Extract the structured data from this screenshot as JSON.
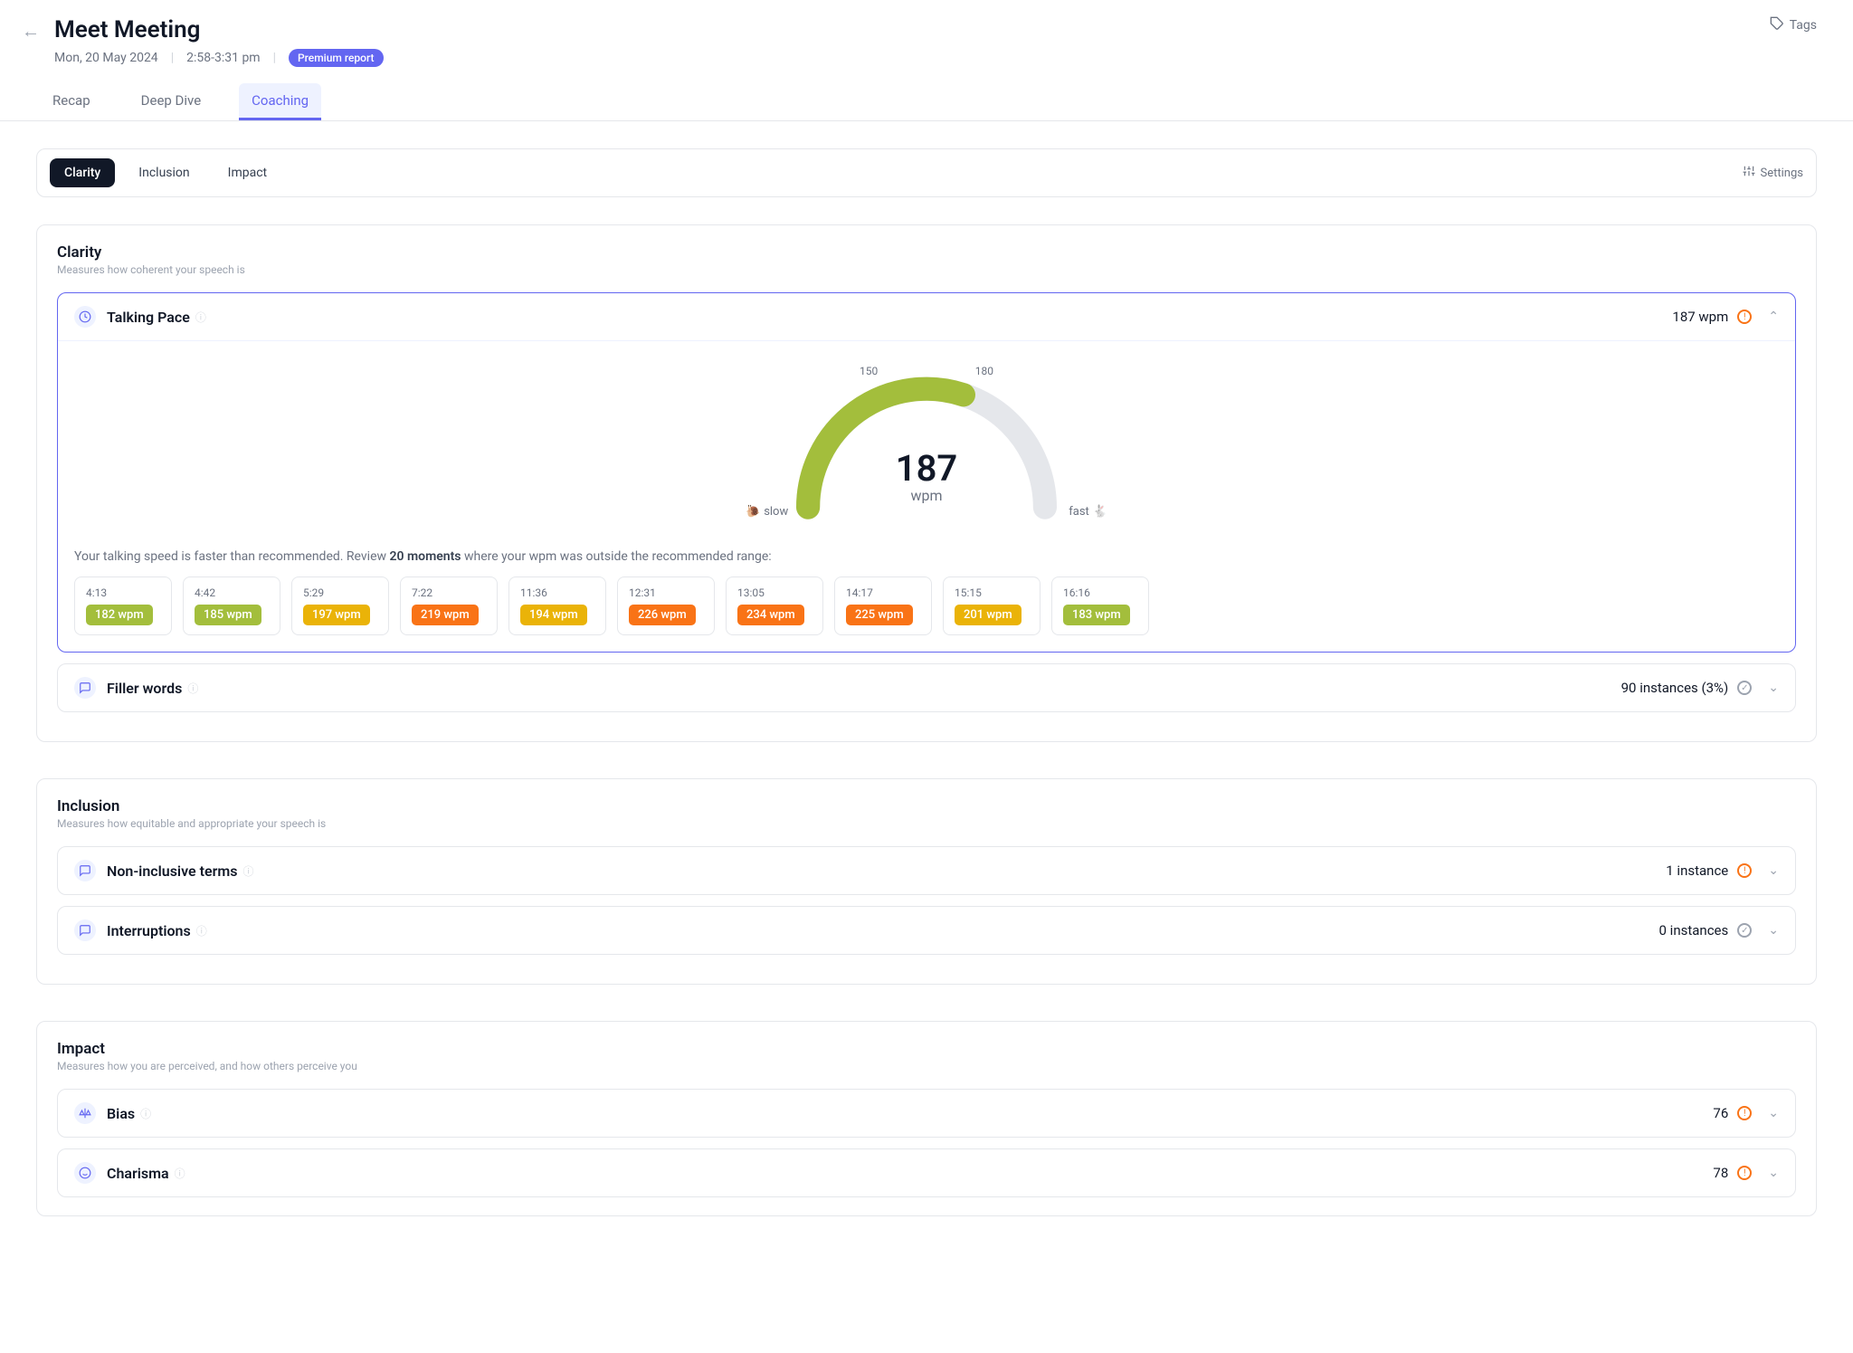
{
  "header": {
    "title": "Meet Meeting",
    "date": "Mon, 20 May 2024",
    "time": "2:58-3:31 pm",
    "premium_badge": "Premium report",
    "tags_label": "Tags"
  },
  "tabs": [
    {
      "label": "Recap",
      "active": false
    },
    {
      "label": "Deep Dive",
      "active": false
    },
    {
      "label": "Coaching",
      "active": true
    }
  ],
  "pills": [
    {
      "label": "Clarity",
      "active": true
    },
    {
      "label": "Inclusion",
      "active": false
    },
    {
      "label": "Impact",
      "active": false
    }
  ],
  "settings_label": "Settings",
  "clarity": {
    "title": "Clarity",
    "subtitle": "Measures how coherent your speech is",
    "talking_pace": {
      "name": "Talking Pace",
      "value": "187 wpm",
      "gauge_value": "187",
      "gauge_unit": "wpm",
      "tick_low": "150",
      "tick_high": "180",
      "slow_label": "slow",
      "fast_label": "fast",
      "review_prefix": "Your talking speed is faster than recommended. Review",
      "review_bold": "20 moments",
      "review_suffix": "where your wpm was outside the recommended range:"
    },
    "moments": [
      {
        "time": "4:13",
        "wpm": "182 wpm",
        "level": "green"
      },
      {
        "time": "4:42",
        "wpm": "185 wpm",
        "level": "green"
      },
      {
        "time": "5:29",
        "wpm": "197 wpm",
        "level": "yellow"
      },
      {
        "time": "7:22",
        "wpm": "219 wpm",
        "level": "orange"
      },
      {
        "time": "11:36",
        "wpm": "194 wpm",
        "level": "yellow"
      },
      {
        "time": "12:31",
        "wpm": "226 wpm",
        "level": "orange"
      },
      {
        "time": "13:05",
        "wpm": "234 wpm",
        "level": "orange"
      },
      {
        "time": "14:17",
        "wpm": "225 wpm",
        "level": "orange"
      },
      {
        "time": "15:15",
        "wpm": "201 wpm",
        "level": "yellow"
      },
      {
        "time": "16:16",
        "wpm": "183 wpm",
        "level": "green"
      }
    ],
    "filler_words": {
      "name": "Filler words",
      "value": "90 instances (3%)"
    }
  },
  "inclusion": {
    "title": "Inclusion",
    "subtitle": "Measures how equitable and appropriate your speech is",
    "non_inclusive": {
      "name": "Non-inclusive terms",
      "value": "1 instance"
    },
    "interruptions": {
      "name": "Interruptions",
      "value": "0 instances"
    }
  },
  "impact": {
    "title": "Impact",
    "subtitle": "Measures how you are perceived, and how others perceive you",
    "bias": {
      "name": "Bias",
      "value": "76"
    },
    "charisma": {
      "name": "Charisma",
      "value": "78"
    }
  },
  "chart_data": {
    "type": "gauge",
    "value": 187,
    "unit": "wpm",
    "recommended_range": [
      150,
      180
    ],
    "display_range": [
      100,
      260
    ],
    "labels_low_high": [
      "slow",
      "fast"
    ]
  }
}
